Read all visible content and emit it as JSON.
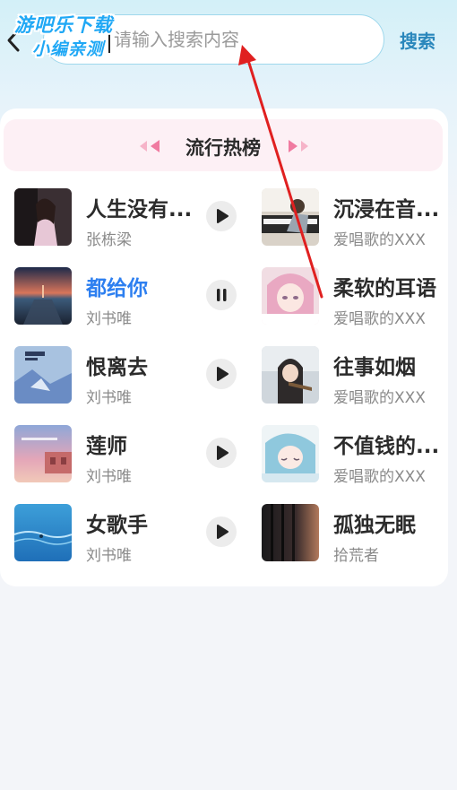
{
  "watermark": {
    "line1": "游吧乐下载",
    "line2": "小编亲测"
  },
  "search": {
    "placeholder": "请输入搜索内容",
    "value": "",
    "button_label": "搜索"
  },
  "panel": {
    "title": "流行热榜"
  },
  "songs": [
    {
      "title": "人生没有...",
      "artist": "张栋梁",
      "state": "play"
    },
    {
      "title": "沉浸在音...",
      "artist": "爱唱歌的XXX",
      "state": "none"
    },
    {
      "title": "都给你",
      "artist": "刘书唯",
      "state": "pause",
      "active": true
    },
    {
      "title": "柔软的耳语",
      "artist": "爱唱歌的XXX",
      "state": "none"
    },
    {
      "title": "恨离去",
      "artist": "刘书唯",
      "state": "play"
    },
    {
      "title": "往事如烟",
      "artist": "爱唱歌的XXX",
      "state": "none"
    },
    {
      "title": "莲师",
      "artist": "刘书唯",
      "state": "play"
    },
    {
      "title": "不值钱的...",
      "artist": "爱唱歌的XXX",
      "state": "none"
    },
    {
      "title": "女歌手",
      "artist": "刘书唯",
      "state": "play"
    },
    {
      "title": "孤独无眠",
      "artist": "拾荒者",
      "state": "none"
    }
  ],
  "colors": {
    "accent": "#2d7ff0",
    "search_button": "#2a87bc",
    "header_bg": "#fdf0f5",
    "annotation": "#e02020"
  }
}
